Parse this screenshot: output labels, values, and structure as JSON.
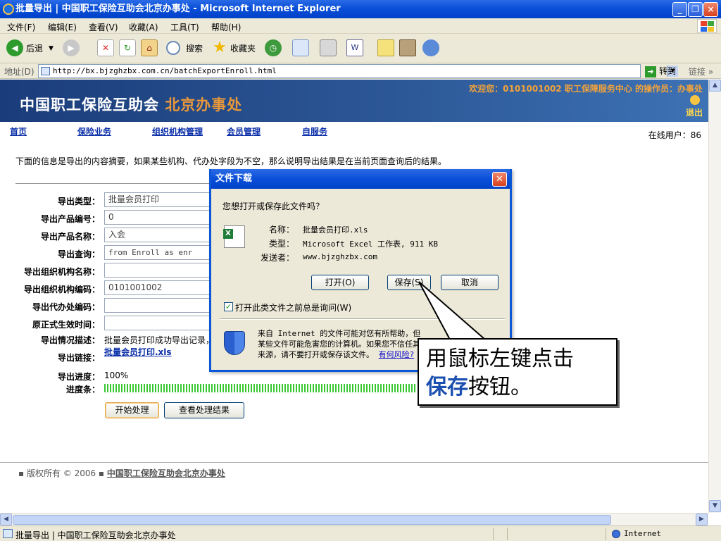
{
  "window": {
    "title": "批量导出 | 中国职工保险互助会北京办事处 - Microsoft Internet Explorer",
    "min_label": "_",
    "max_label": "❐",
    "close_label": "×"
  },
  "menu": [
    "文件(F)",
    "编辑(E)",
    "查看(V)",
    "收藏(A)",
    "工具(T)",
    "帮助(H)"
  ],
  "toolbar": {
    "back": "后退",
    "search": "搜索",
    "favorites": "收藏夹"
  },
  "address": {
    "label": "地址(D)",
    "url": "http://bx.bjzghzbx.com.cn/batchExportEnroll.html",
    "go": "转到",
    "links": "链接",
    "go_arrow": "➜",
    "links_more": "»",
    "dropdown": "▼"
  },
  "banner": {
    "title_main": "中国职工保险互助会",
    "title_sub": "北京办事处",
    "welcome": "欢迎您：0101001002 职工保障服务中心 的操作员：办事处",
    "logout": "退出"
  },
  "nav": {
    "items": [
      "首页",
      "保险业务",
      "组织机构管理",
      "会员管理",
      "自服务"
    ],
    "online": "在线用户：86"
  },
  "summary": "下面的信息是导出的内容摘要，如果某些机构、代办处字段为不空，那么说明导出结果是在当前页面查询后的结果。",
  "form": {
    "export_type_label": "导出类型：",
    "export_type": "批量会员打印",
    "product_no_label": "导出产品编号：",
    "product_no": "0",
    "product_name_label": "导出产品名称：",
    "product_name": "入会",
    "query_label": "导出查询：",
    "query": " from Enroll   as enr",
    "org_name_label": "导出组织机构名称：",
    "org_name": "",
    "org_code_label": "导出组织机构编码：",
    "org_code": "0101001002",
    "agency_code_label": "导出代办处编码：",
    "agency_code": "",
    "effective_time_label": "原正式生效时间：",
    "effective_time": "",
    "description_label": "导出情况描述：",
    "description": "批量会员打印成功导出记录，",
    "link_label": "导出链接：",
    "link": "批量会员打印.xls",
    "progress_label": "导出进度：",
    "progress": "100%",
    "progress_fraction": 1.0,
    "bar_label": "进度条：",
    "start_button": "开始处理",
    "view_button": "查看处理结果"
  },
  "footer": {
    "prefix": "▪ 版权所有 © 2006 ▪",
    "org": "中国职工保险互助会北京办事处"
  },
  "status": {
    "text": "批量导出 | 中国职工保险互助会北京办事处",
    "zone": "Internet"
  },
  "dialog": {
    "title": "文件下载",
    "question": "您想打开或保存此文件吗？",
    "name_label": "名称：",
    "name": "批量会员打印.xls",
    "type_label": "类型：",
    "type": "Microsoft Excel 工作表, 911 KB",
    "from_label": "发送者：",
    "from": "www.bjzghzbx.com",
    "open_button": "打开(O)",
    "save_button": "保存(S)",
    "cancel_button": "取消",
    "checkbox_label": "打开此类文件之前总是询问(W)",
    "checkbox_checked": true,
    "warning": "来自 Internet 的文件可能对您有所帮助，但某些文件可能危害您的计算机。如果您不信任其来源，请不要打开或保存该文件。",
    "risk_link": "有何风险?"
  },
  "callout": {
    "line1": "用鼠标左键点击",
    "highlight": "保存",
    "line2_rest": "按钮。"
  },
  "colors": {
    "title_blue": "#0a4fd8",
    "banner_blue": "#2c5796",
    "nav_link": "#0a2ea8",
    "progress_green": "#39c832",
    "callout_highlight": "#1b4fb0"
  }
}
